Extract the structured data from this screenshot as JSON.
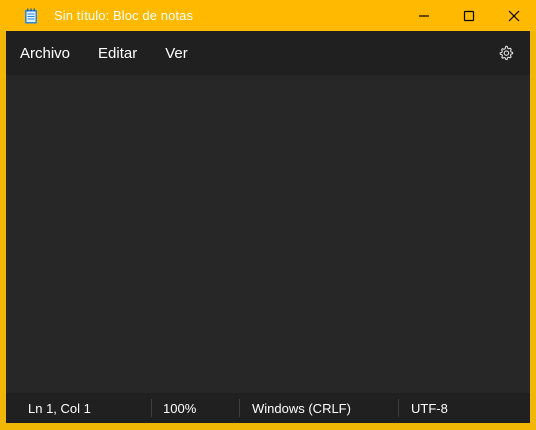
{
  "window": {
    "title": "Sin título: Bloc de notas",
    "accent_color": "#ffb900",
    "app_icon": "notepad-icon",
    "controls": [
      "minimize-icon",
      "maximize-icon",
      "close-icon"
    ]
  },
  "menu": {
    "items": [
      {
        "label": "Archivo"
      },
      {
        "label": "Editar"
      },
      {
        "label": "Ver"
      }
    ],
    "settings_icon": "gear-icon"
  },
  "editor": {
    "content": ""
  },
  "status": {
    "position": "Ln 1, Col 1",
    "zoom": "100%",
    "line_ending": "Windows (CRLF)",
    "encoding": "UTF-8"
  }
}
